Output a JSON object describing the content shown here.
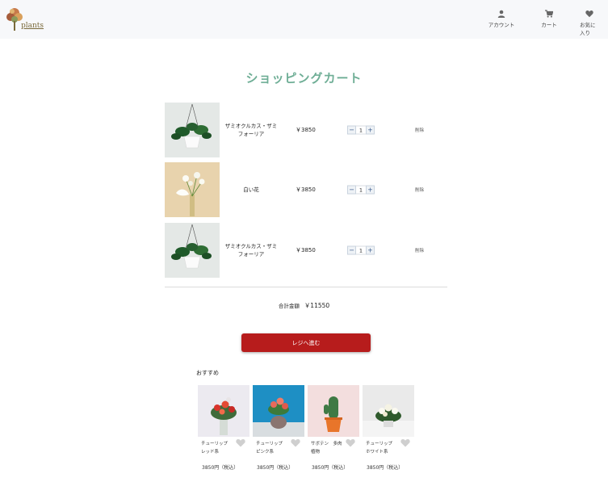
{
  "header": {
    "logo_text": "plants",
    "nav": {
      "account": "アカウント",
      "cart": "カート",
      "favorites": "お気に入り"
    }
  },
  "page_title": "ショッピングカート",
  "cart": {
    "items": [
      {
        "name": "ザミオクルカス・ザミフォーリア",
        "price": "￥3850",
        "qty": "1",
        "remove": "削除",
        "image": "hanging-green-plant"
      },
      {
        "name": "白い花",
        "price": "￥3850",
        "qty": "1",
        "remove": "削除",
        "image": "white-flowers-vase"
      },
      {
        "name": "ザミオクルカス・ザミフォーリア",
        "price": "￥3850",
        "qty": "1",
        "remove": "削除",
        "image": "hanging-green-plant"
      }
    ],
    "qty_minus": "−",
    "qty_plus": "+"
  },
  "total": {
    "label": "合計金額",
    "value": "￥11550"
  },
  "checkout_label": "レジへ進む",
  "recommendations": {
    "title": "おすすめ",
    "items": [
      {
        "name_line1": "チューリップ",
        "name_line2": "レッド系",
        "price": "3850円（税込）",
        "image": "red-tulip-bouquet"
      },
      {
        "name_line1": "チューリップ",
        "name_line2": "ピンク系",
        "price": "3850円（税込）",
        "image": "pink-tulip-blue-bg"
      },
      {
        "name_line1": "サボテン　多肉",
        "name_line2": "植物",
        "price": "3850円（税込）",
        "image": "cactus-orange-pot"
      },
      {
        "name_line1": "チューリップ",
        "name_line2": "ホワイト系",
        "price": "3850円（税込）",
        "image": "white-flower-bouquet"
      }
    ]
  },
  "colors": {
    "accent_title": "#6fae96",
    "checkout": "#b71c1c",
    "header_bg": "#f7f8fa"
  }
}
